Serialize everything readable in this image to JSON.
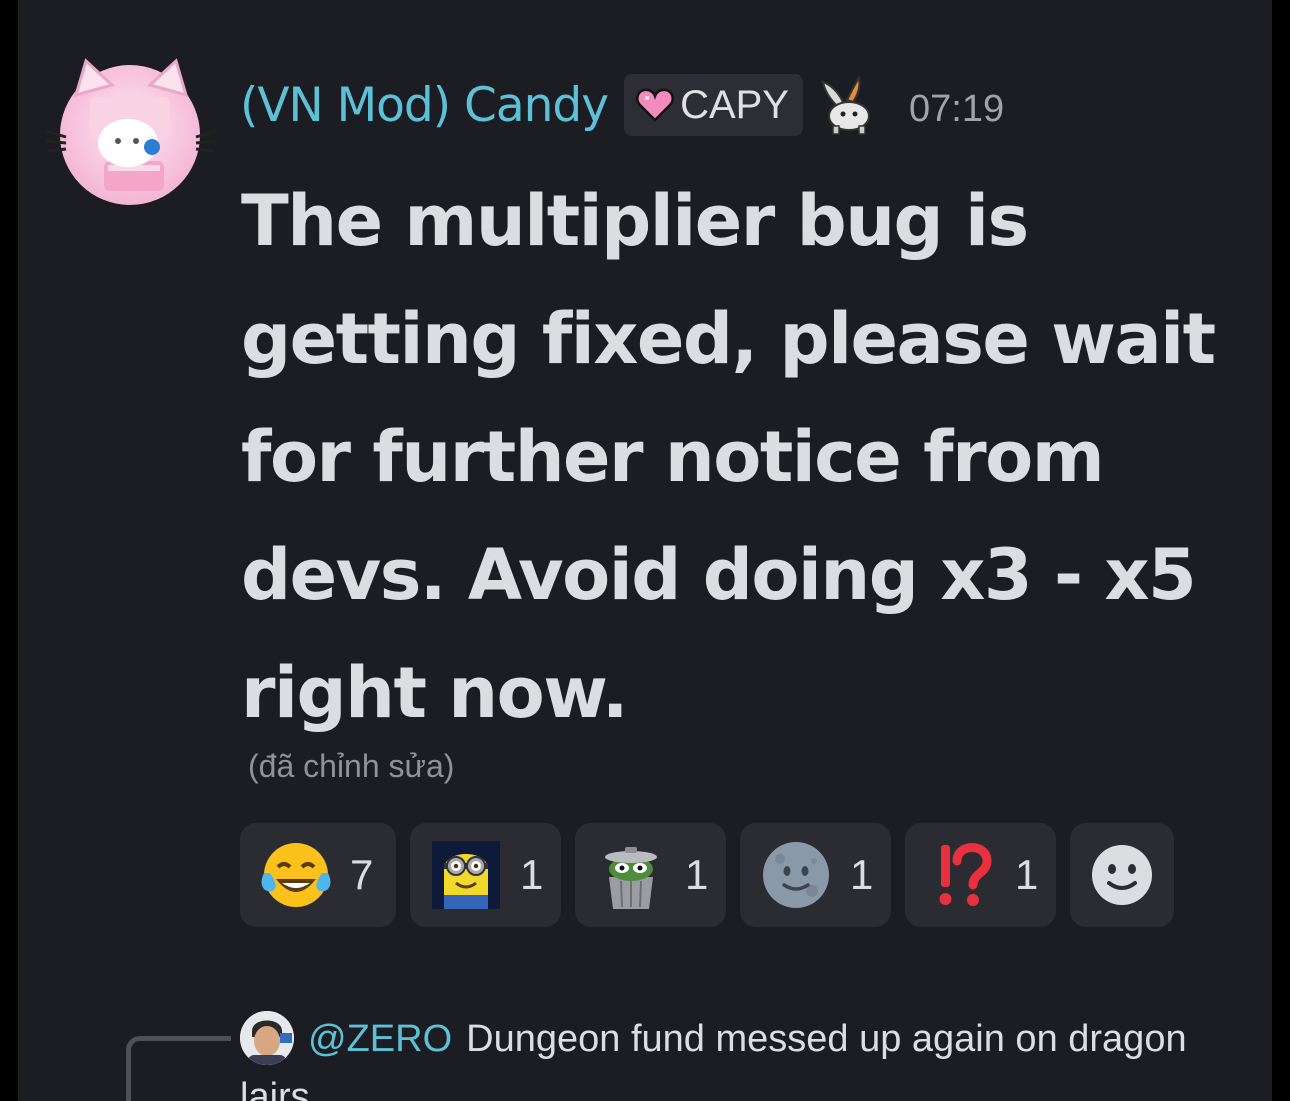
{
  "header": {
    "username": "(VN Mod) Candy",
    "tag_label": "CAPY",
    "timestamp": "07:19"
  },
  "message": {
    "text": "The multiplier bug is getting fixed, please wait for further notice from devs. Avoid doing x3 - x5 right now.",
    "edited_label": "(đã chỉnh sửa)"
  },
  "reactions": [
    {
      "icon": "joy-tears-emoji",
      "count": "7"
    },
    {
      "icon": "minion-emoji",
      "count": "1"
    },
    {
      "icon": "trash-can-frog-emoji",
      "count": "1"
    },
    {
      "icon": "moon-face-emoji",
      "count": "1"
    },
    {
      "icon": "interrobang-emoji",
      "count": "1"
    },
    {
      "icon": "add-reaction-icon",
      "count": ""
    }
  ],
  "reply": {
    "username": "@ZERO",
    "text": "Dungeon fund messed up again on dragon lairs"
  },
  "colors": {
    "background": "#1c1d22",
    "username": "#5cc0d6",
    "text": "#dbdee1",
    "reaction_bg": "#2b2c32"
  }
}
